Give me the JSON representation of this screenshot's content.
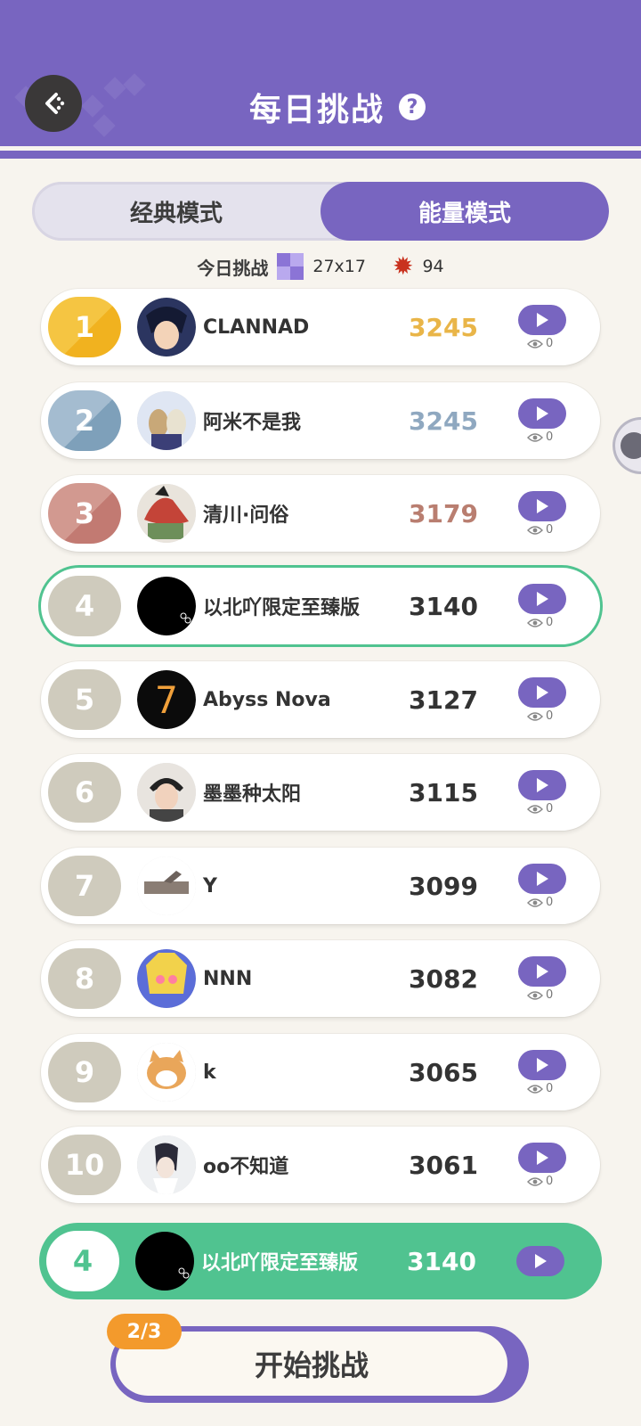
{
  "header": {
    "title": "每日挑战"
  },
  "mode_tabs": [
    {
      "label": "经典模式",
      "active": false
    },
    {
      "label": "能量模式",
      "active": true
    }
  ],
  "today": {
    "label": "今日挑战",
    "grid_size": "27x17",
    "mines": "94"
  },
  "leaderboard": [
    {
      "rank": "1",
      "name": "CLANNAD",
      "score": "3245",
      "views": "0",
      "badge_color": "#f5c542",
      "score_color": "#e9b548"
    },
    {
      "rank": "2",
      "name": "阿米不是我",
      "score": "3245",
      "views": "0",
      "badge_color": "#a4bcd0",
      "score_color": "#8fa8c0"
    },
    {
      "rank": "3",
      "name": "清川·问俗",
      "score": "3179",
      "views": "0",
      "badge_color": "#d29990",
      "score_color": "#b97e70"
    },
    {
      "rank": "4",
      "name": "以北吖限定至臻版",
      "score": "3140",
      "views": "0",
      "badge_color": "#cfcbbd",
      "score_color": "#333333"
    },
    {
      "rank": "5",
      "name": "Abyss Nova",
      "score": "3127",
      "views": "0",
      "badge_color": "#cfcbbd",
      "score_color": "#333333"
    },
    {
      "rank": "6",
      "name": "墨墨种太阳",
      "score": "3115",
      "views": "0",
      "badge_color": "#cfcbbd",
      "score_color": "#333333"
    },
    {
      "rank": "7",
      "name": "Y",
      "score": "3099",
      "views": "0",
      "badge_color": "#cfcbbd",
      "score_color": "#333333"
    },
    {
      "rank": "8",
      "name": "NNN",
      "score": "3082",
      "views": "0",
      "badge_color": "#cfcbbd",
      "score_color": "#333333"
    },
    {
      "rank": "9",
      "name": "k",
      "score": "3065",
      "views": "0",
      "badge_color": "#cfcbbd",
      "score_color": "#333333"
    },
    {
      "rank": "10",
      "name": "oo不知道",
      "score": "3061",
      "views": "0",
      "badge_color": "#cfcbbd",
      "score_color": "#333333"
    }
  ],
  "my_entry": {
    "rank": "4",
    "name": "以北吖限定至臻版",
    "score": "3140"
  },
  "start": {
    "label": "开始挑战",
    "attempts": "2/3"
  },
  "colors": {
    "accent": "#7865c0",
    "highlight": "#50c390",
    "orange": "#f39a2c"
  },
  "icons": [
    "back-icon",
    "help-icon",
    "grid-icon",
    "mine-icon",
    "play-icon",
    "eye-icon"
  ]
}
